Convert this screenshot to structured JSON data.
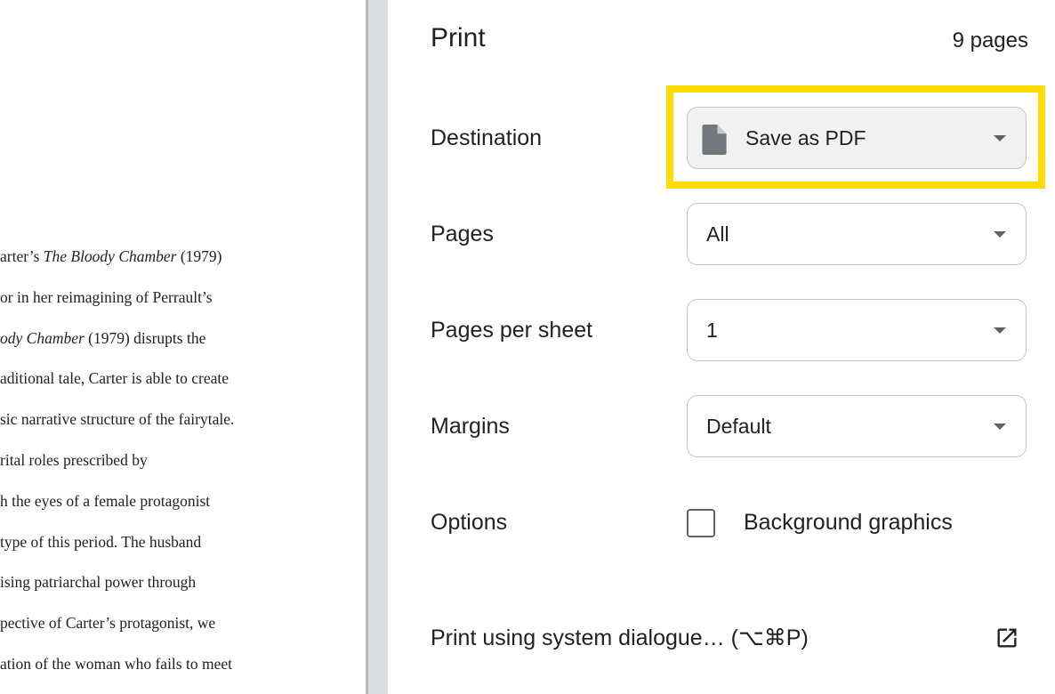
{
  "preview": {
    "lines": [
      {
        "before": "arter’s ",
        "em": "The Bloody Chamber",
        "after": " (1979)"
      },
      {
        "before": "or in her reimagining of Perrault’s",
        "em": "",
        "after": ""
      },
      {
        "before": "",
        "em": "ody Chamber",
        "after": " (1979) disrupts the"
      },
      {
        "before": "aditional tale, Carter is able to create",
        "em": "",
        "after": ""
      },
      {
        "before": "sic narrative structure of the fairytale.",
        "em": "",
        "after": ""
      },
      {
        "before": "rital roles prescribed by",
        "em": "",
        "after": ""
      },
      {
        "before": "h the eyes of a female protagonist",
        "em": "",
        "after": ""
      },
      {
        "before": "type of this period. The husband",
        "em": "",
        "after": ""
      },
      {
        "before": "ising patriarchal power through",
        "em": "",
        "after": ""
      },
      {
        "before": "pective of Carter’s protagonist, we",
        "em": "",
        "after": ""
      },
      {
        "before": "ation of the woman who fails to meet",
        "em": "",
        "after": ""
      }
    ]
  },
  "panel": {
    "title": "Print",
    "sheet_count": "9 pages",
    "destination": {
      "label": "Destination",
      "value": "Save as PDF",
      "icon": "file-icon"
    },
    "pages": {
      "label": "Pages",
      "value": "All"
    },
    "pages_per_sheet": {
      "label": "Pages per sheet",
      "value": "1"
    },
    "margins": {
      "label": "Margins",
      "value": "Default"
    },
    "options": {
      "label": "Options",
      "background_graphics": "Background graphics",
      "background_graphics_checked": false
    },
    "system_dialog": "Print using system dialogue… (⌥⌘P)",
    "highlight_color": "#fddd00"
  }
}
